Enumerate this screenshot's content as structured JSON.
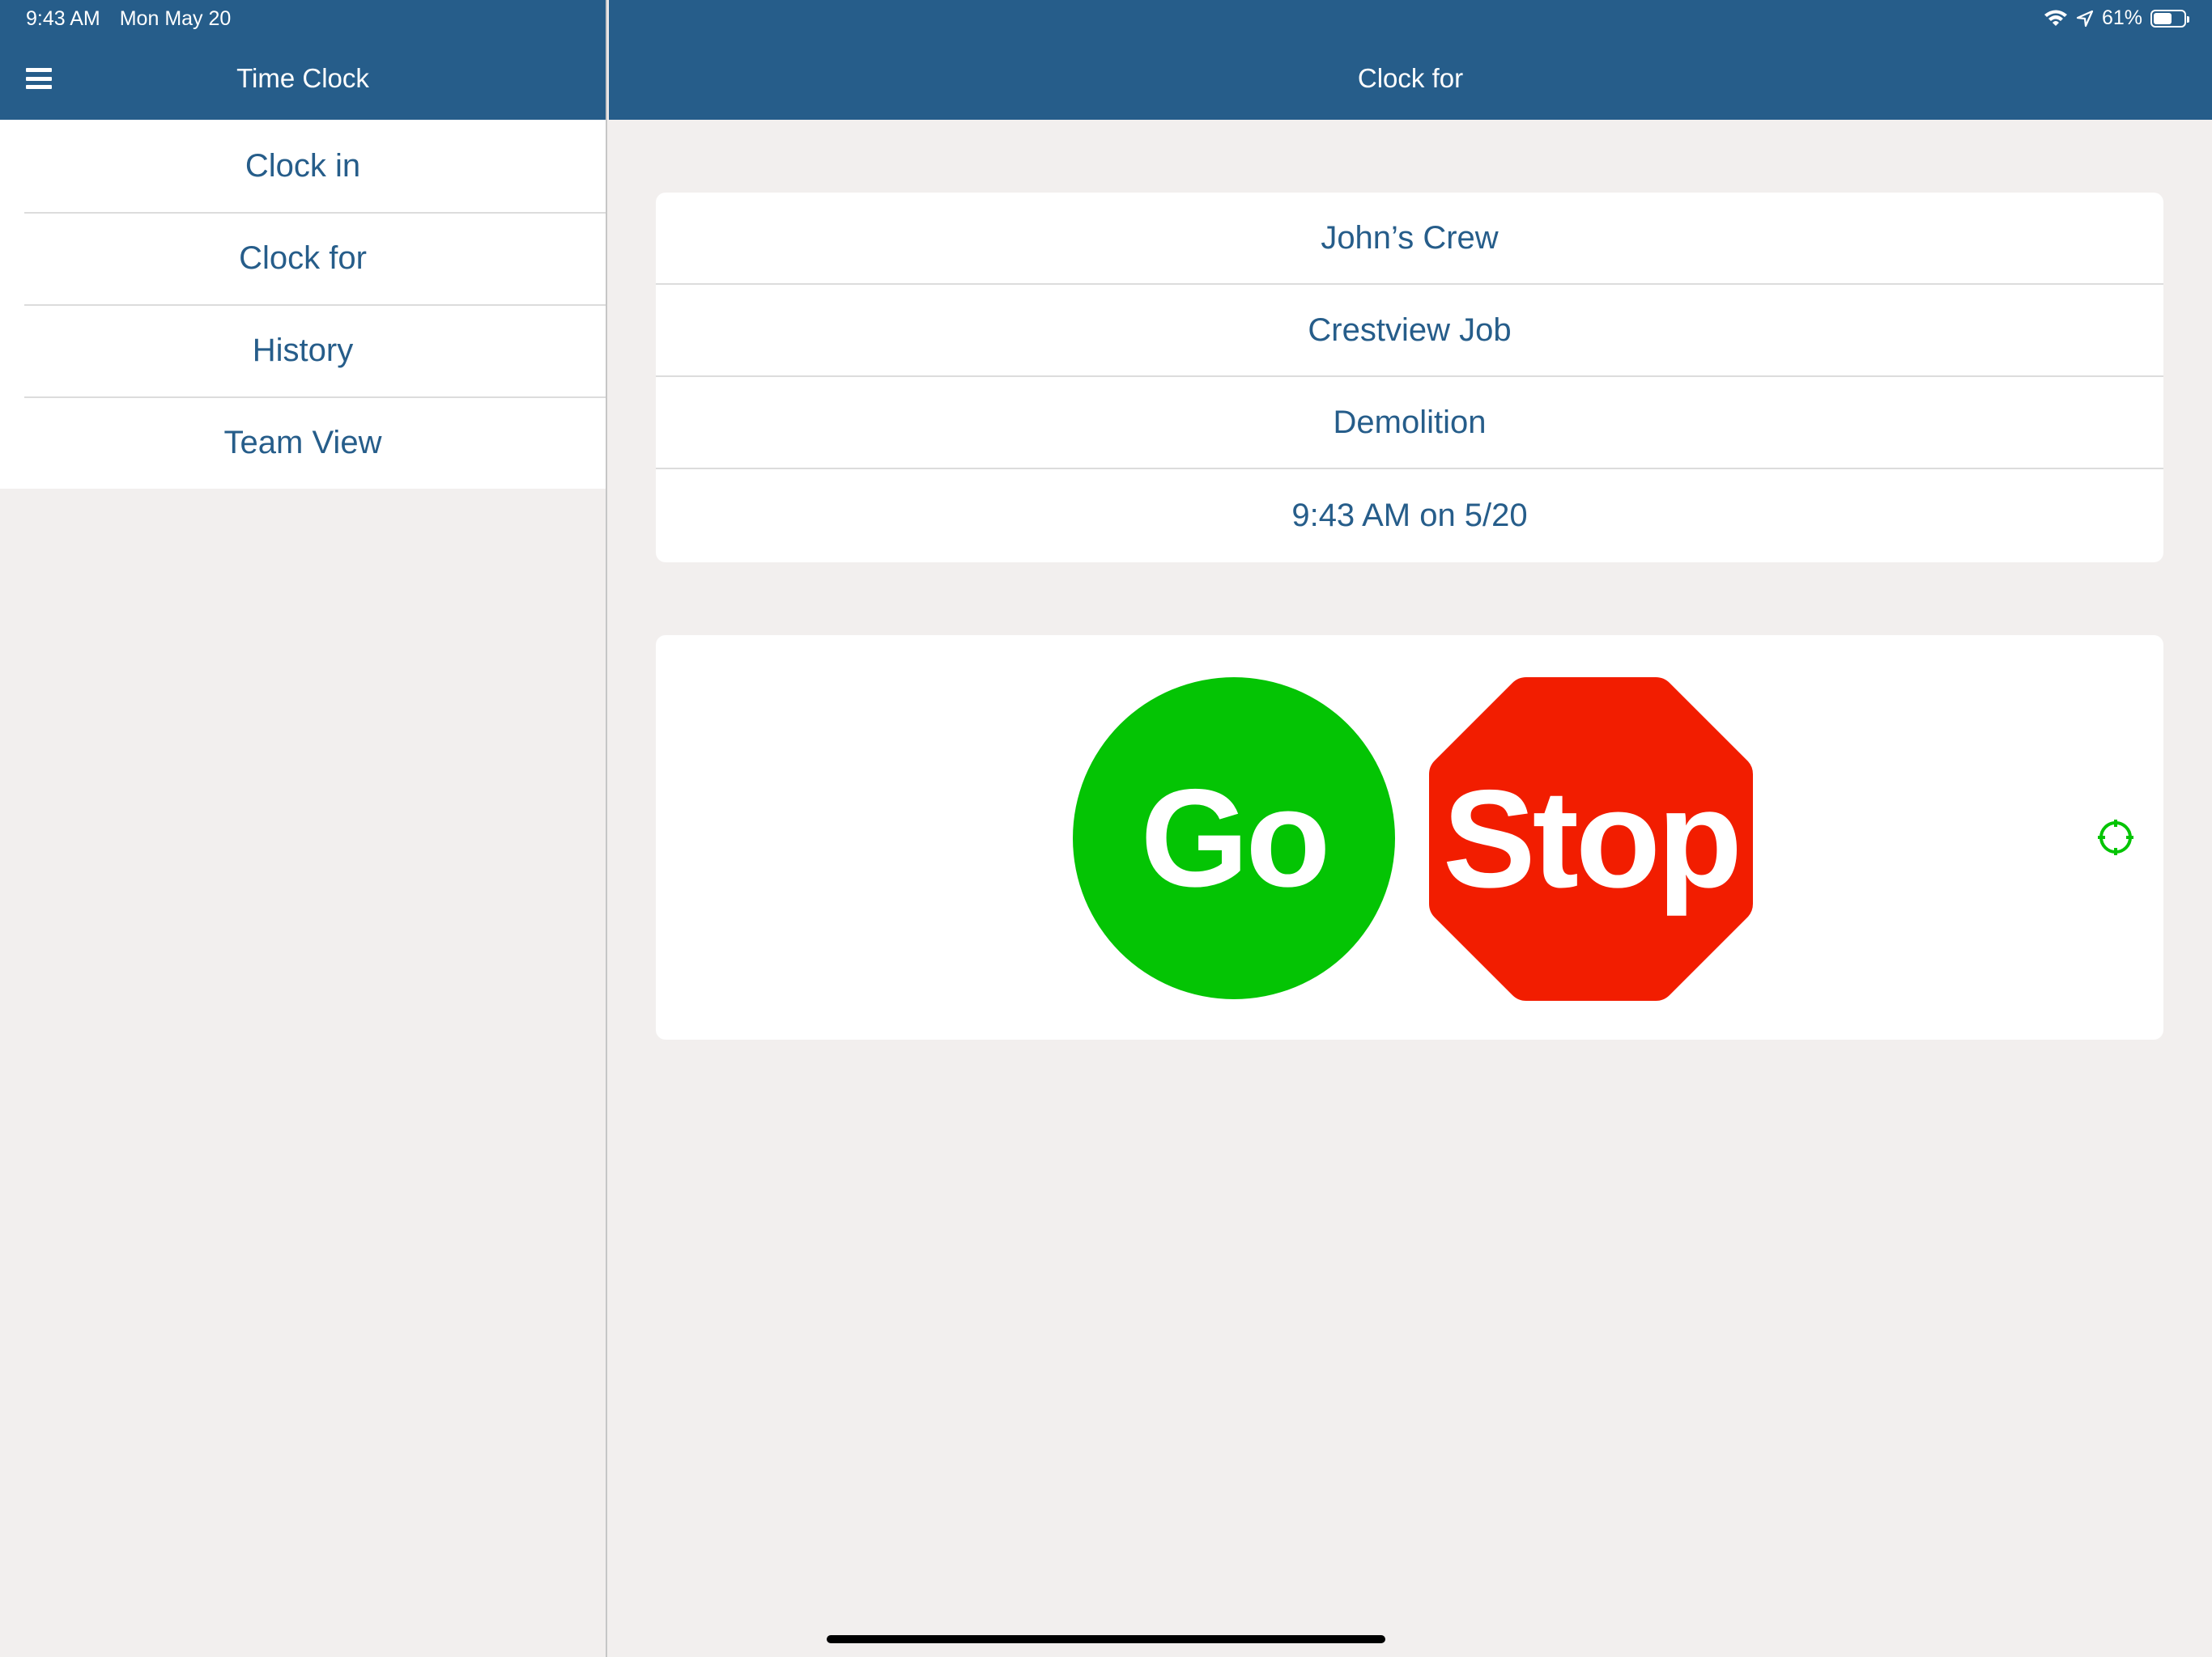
{
  "status_bar": {
    "time": "9:43 AM",
    "date": "Mon May 20",
    "battery": "61%",
    "battery_level": 0.61,
    "icons": [
      "wifi-icon",
      "location-arrow-icon",
      "battery-icon"
    ]
  },
  "sidebar": {
    "title": "Time Clock",
    "menu_icon": "hamburger-icon",
    "items": [
      {
        "label": "Clock in"
      },
      {
        "label": "Clock for"
      },
      {
        "label": "History"
      },
      {
        "label": "Team View"
      }
    ]
  },
  "main": {
    "title": "Clock for",
    "details": {
      "crew": "John’s Crew",
      "job": "Crestview Job",
      "task": "Demolition",
      "time": "9:43 AM on 5/20"
    },
    "actions": {
      "go_label": "Go",
      "stop_label": "Stop",
      "locate_icon": "crosshair-icon"
    }
  },
  "colors": {
    "header": "#265d8a",
    "text_accent": "#265d8a",
    "go": "#04c404",
    "stop": "#f21d00",
    "background": "#f2efee",
    "locate": "#04c404"
  }
}
